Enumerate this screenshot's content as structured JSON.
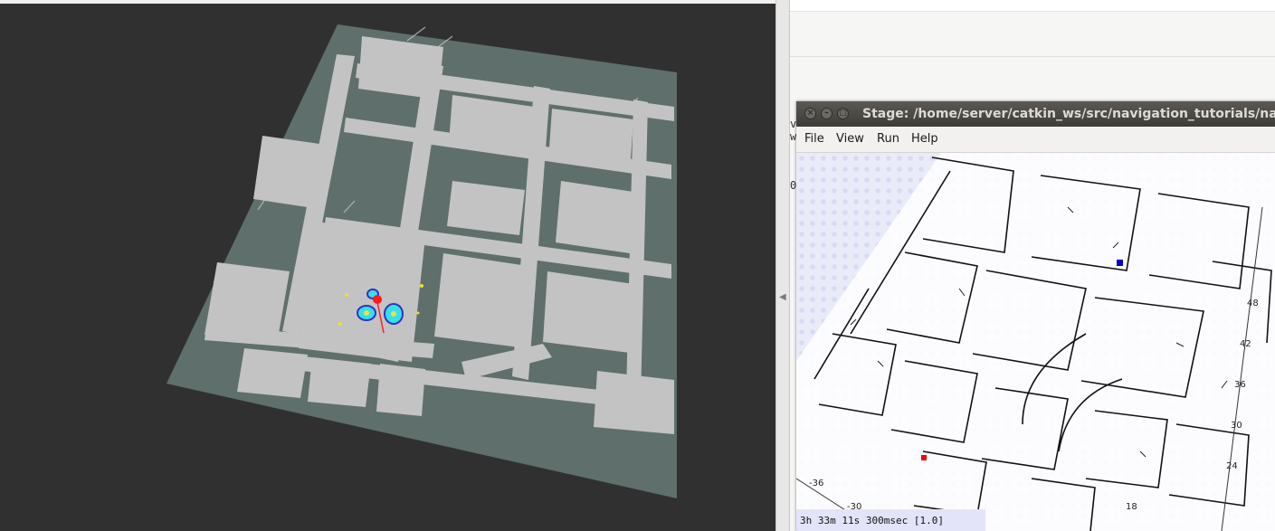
{
  "stage_window": {
    "title": "Stage: /home/server/catkin_ws/src/navigation_tutorials/navigation_stage",
    "menu": [
      "File",
      "View",
      "Run",
      "Help"
    ],
    "status": "3h 33m 11s 300msec [1.0]",
    "axis_labels": [
      "48",
      "42",
      "36",
      "30",
      "24",
      "18",
      "-36",
      "-30"
    ]
  },
  "background_terminal_peek": [
    "v",
    "w",
    "0"
  ],
  "colors": {
    "rviz_background": "#303030",
    "occupancy_unknown": "#5f6f6c",
    "occupancy_free": "#c3c3c3",
    "stage_background": "#e9ebf9",
    "titlebar": "#4a4945",
    "robot_red": "#ff0000",
    "goal_blue": "#0000cc"
  },
  "icons": {
    "close": "close-icon",
    "minimize": "minimize-icon",
    "maximize": "maximize-icon",
    "splitter": "collapse-arrow-icon"
  }
}
